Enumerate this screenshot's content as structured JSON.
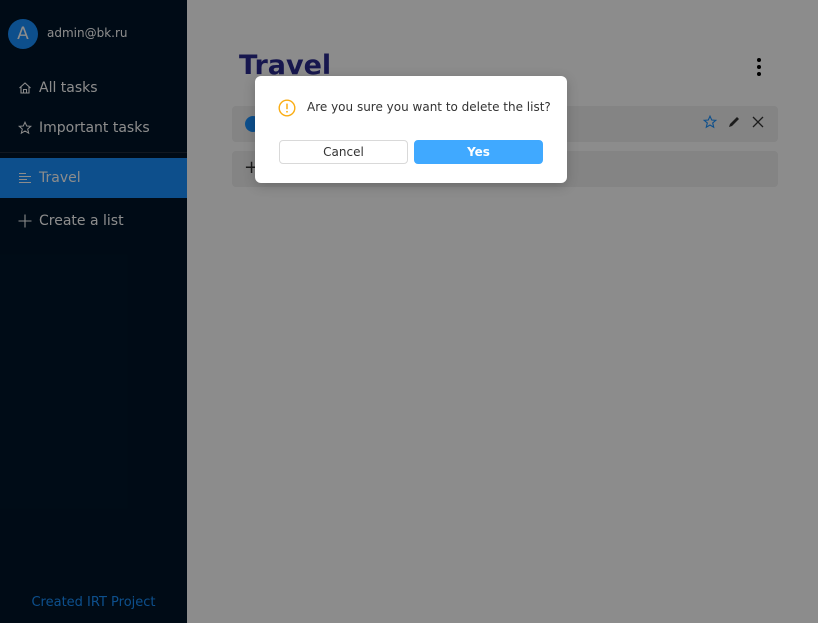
{
  "user": {
    "avatar_letter": "A",
    "email": "admin@bk.ru"
  },
  "sidebar": {
    "items": [
      {
        "label": "All tasks"
      },
      {
        "label": "Important tasks"
      },
      {
        "label": "Travel"
      },
      {
        "label": "Create a list"
      }
    ],
    "footer": "Created IRT Project"
  },
  "main": {
    "title": "Travel"
  },
  "modal": {
    "message": "Are you sure you want to delete the list?",
    "cancel_label": "Cancel",
    "confirm_label": "Yes"
  },
  "colors": {
    "sidebar_bg": "#001529",
    "accent": "#1890ff",
    "title": "#2a2a8f",
    "warning": "#faad14"
  }
}
